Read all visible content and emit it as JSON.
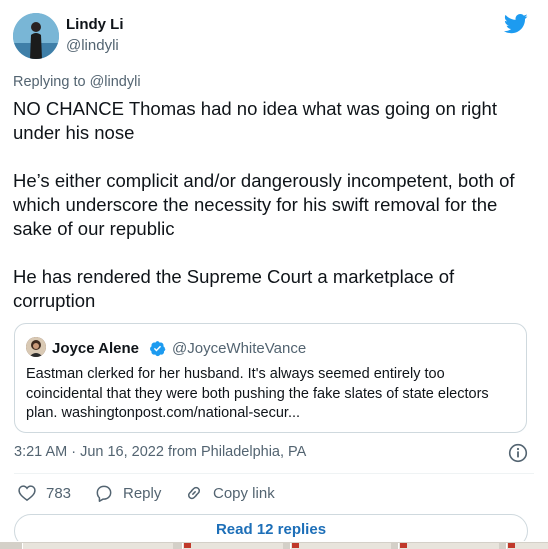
{
  "author": {
    "name": "Lindy Li",
    "handle": "@lindyli"
  },
  "reply_to": {
    "prefix": "Replying to",
    "handle": "@lindyli"
  },
  "body": {
    "p1": "NO CHANCE Thomas had no idea what was going on right under his nose",
    "p2": "He’s either complicit and/or dangerously incompetent, both of which underscore the necessity for his swift removal for the sake of our republic",
    "p3": "He has rendered the Supreme Court a marketplace of corruption"
  },
  "quote": {
    "name": "Joyce Alene",
    "handle": "@JoyceWhiteVance",
    "text": "Eastman clerked for her husband. It's always seemed entirely too coincidental that they were both pushing the fake slates of state electors plan. washingtonpost.com/national-secur..."
  },
  "meta": {
    "timestamp": "3:21 AM · Jun 16, 2022 from Philadelphia, PA"
  },
  "actions": {
    "like_count": "783",
    "reply_label": "Reply",
    "copy_label": "Copy link"
  },
  "read_replies": "Read 12 replies",
  "colors": {
    "brand_blue": "#1d9bf0",
    "link_blue": "#1d6fb8",
    "muted": "#536471",
    "border": "#cfd9de"
  },
  "icons": [
    "twitter-bird-icon",
    "verified-badge-icon",
    "info-icon",
    "heart-icon",
    "reply-bubble-icon",
    "link-icon"
  ]
}
